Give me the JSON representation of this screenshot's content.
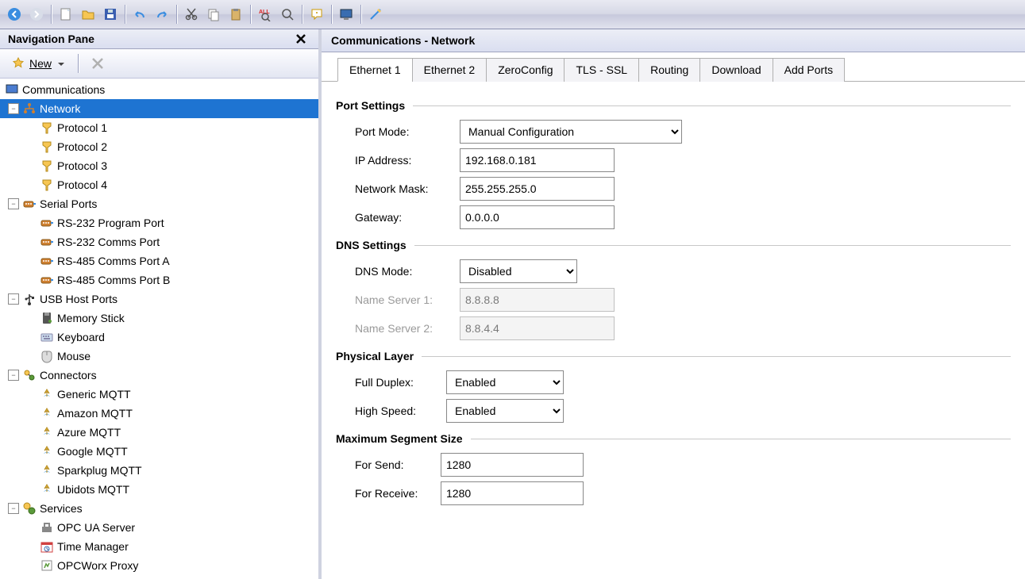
{
  "toolbar_icons": [
    "back",
    "forward",
    "|",
    "new-file",
    "open-folder",
    "save",
    "|",
    "undo",
    "redo",
    "|",
    "cut",
    "copy",
    "paste",
    "|",
    "find-all",
    "find",
    "|",
    "help",
    "|",
    "display",
    "|",
    "wizard"
  ],
  "nav": {
    "title": "Navigation Pane",
    "new_label": "New",
    "tree": [
      {
        "depth": 0,
        "toggle": "",
        "icon": "root",
        "label": "Communications"
      },
      {
        "depth": 1,
        "toggle": "-",
        "icon": "network",
        "label": "Network",
        "selected": true
      },
      {
        "depth": 2,
        "toggle": "",
        "icon": "protocol",
        "label": "Protocol 1"
      },
      {
        "depth": 2,
        "toggle": "",
        "icon": "protocol",
        "label": "Protocol 2"
      },
      {
        "depth": 2,
        "toggle": "",
        "icon": "protocol",
        "label": "Protocol 3"
      },
      {
        "depth": 2,
        "toggle": "",
        "icon": "protocol",
        "label": "Protocol 4"
      },
      {
        "depth": 1,
        "toggle": "-",
        "icon": "serial",
        "label": "Serial Ports"
      },
      {
        "depth": 2,
        "toggle": "",
        "icon": "serial",
        "label": "RS-232 Program Port"
      },
      {
        "depth": 2,
        "toggle": "",
        "icon": "serial",
        "label": "RS-232 Comms Port"
      },
      {
        "depth": 2,
        "toggle": "",
        "icon": "serial",
        "label": "RS-485 Comms Port A"
      },
      {
        "depth": 2,
        "toggle": "",
        "icon": "serial",
        "label": "RS-485 Comms Port B"
      },
      {
        "depth": 1,
        "toggle": "-",
        "icon": "usb",
        "label": "USB Host Ports"
      },
      {
        "depth": 2,
        "toggle": "",
        "icon": "memory",
        "label": "Memory Stick"
      },
      {
        "depth": 2,
        "toggle": "",
        "icon": "keyboard",
        "label": "Keyboard"
      },
      {
        "depth": 2,
        "toggle": "",
        "icon": "mouse",
        "label": "Mouse"
      },
      {
        "depth": 1,
        "toggle": "-",
        "icon": "connectors",
        "label": "Connectors"
      },
      {
        "depth": 2,
        "toggle": "",
        "icon": "mqtt",
        "label": "Generic MQTT"
      },
      {
        "depth": 2,
        "toggle": "",
        "icon": "mqtt",
        "label": "Amazon MQTT"
      },
      {
        "depth": 2,
        "toggle": "",
        "icon": "mqtt",
        "label": "Azure MQTT"
      },
      {
        "depth": 2,
        "toggle": "",
        "icon": "mqtt",
        "label": "Google MQTT"
      },
      {
        "depth": 2,
        "toggle": "",
        "icon": "mqtt",
        "label": "Sparkplug MQTT"
      },
      {
        "depth": 2,
        "toggle": "",
        "icon": "mqtt",
        "label": "Ubidots MQTT"
      },
      {
        "depth": 1,
        "toggle": "-",
        "icon": "services",
        "label": "Services"
      },
      {
        "depth": 2,
        "toggle": "",
        "icon": "opcua",
        "label": "OPC UA Server"
      },
      {
        "depth": 2,
        "toggle": "",
        "icon": "time",
        "label": "Time Manager"
      },
      {
        "depth": 2,
        "toggle": "",
        "icon": "opcworx",
        "label": "OPCWorx Proxy"
      }
    ]
  },
  "main": {
    "title": "Communications - Network",
    "tabs": [
      "Ethernet 1",
      "Ethernet 2",
      "ZeroConfig",
      "TLS - SSL",
      "Routing",
      "Download",
      "Add Ports"
    ],
    "active_tab": 0,
    "port_settings": {
      "title": "Port Settings",
      "port_mode_label": "Port Mode:",
      "port_mode_value": "Manual Configuration",
      "ip_label": "IP Address:",
      "ip_value": "192.168.0.181",
      "mask_label": "Network Mask:",
      "mask_value": "255.255.255.0",
      "gateway_label": "Gateway:",
      "gateway_value": "0.0.0.0"
    },
    "dns_settings": {
      "title": "DNS Settings",
      "mode_label": "DNS Mode:",
      "mode_value": "Disabled",
      "ns1_label": "Name Server 1:",
      "ns1_value": "8.8.8.8",
      "ns2_label": "Name Server 2:",
      "ns2_value": "8.8.4.4"
    },
    "physical_layer": {
      "title": "Physical Layer",
      "full_duplex_label": "Full Duplex:",
      "full_duplex_value": "Enabled",
      "high_speed_label": "High Speed:",
      "high_speed_value": "Enabled"
    },
    "mss": {
      "title": "Maximum Segment Size",
      "send_label": "For Send:",
      "send_value": "1280",
      "recv_label": "For Receive:",
      "recv_value": "1280"
    }
  }
}
